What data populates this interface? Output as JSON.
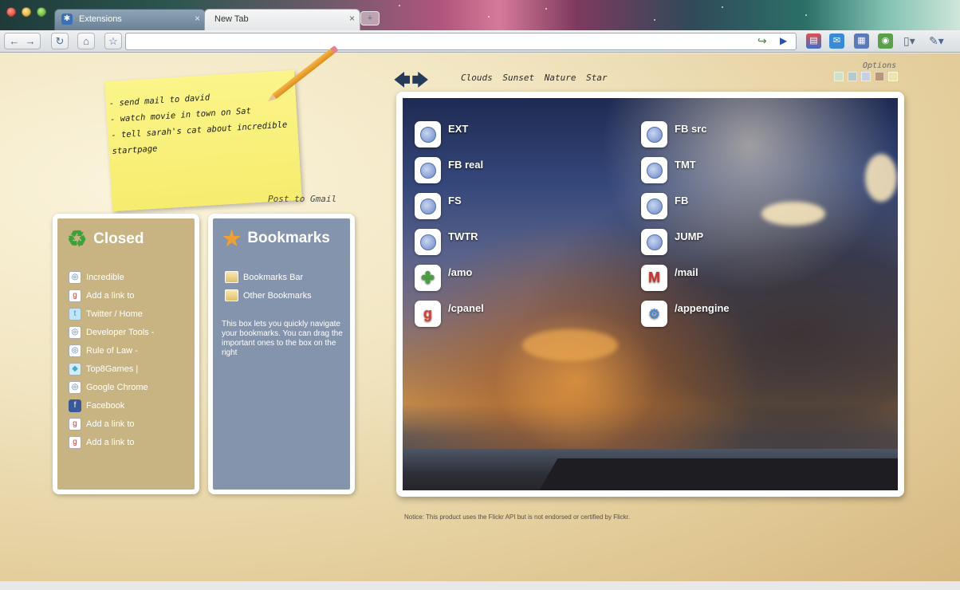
{
  "window": {
    "tabs": [
      {
        "label": "Extensions",
        "active": false
      },
      {
        "label": "New Tab",
        "active": true
      }
    ]
  },
  "toolbar": {
    "url": "",
    "extension_icons": [
      "rss-icon",
      "mail-icon",
      "calendar-icon",
      "reader-icon",
      "page-icon",
      "wrench-icon"
    ]
  },
  "sticky_note": {
    "lines": [
      "- send mail to david",
      "- watch movie in town on Sat",
      "- tell sarah's cat about incredible",
      "startpage"
    ],
    "post_label": "Post to Gmail"
  },
  "themes": {
    "prev_arrow": "🡄",
    "next_arrow": "🡆",
    "links": [
      "Clouds",
      "Sunset",
      "Nature",
      "Star"
    ],
    "options_label": "Options",
    "swatches": [
      "#cfe0c4",
      "#b8c8c8",
      "#c8d0e4",
      "#b89878",
      "#efe4b0"
    ]
  },
  "closed_panel": {
    "title": "Closed",
    "items": [
      {
        "label": "Incredible",
        "icon": "globe-icon"
      },
      {
        "label": "Add a link to",
        "icon": "google-icon"
      },
      {
        "label": "Twitter / Home",
        "icon": "twitter-icon"
      },
      {
        "label": "Developer Tools -",
        "icon": "globe-icon"
      },
      {
        "label": "Rule of Law -",
        "icon": "globe-icon"
      },
      {
        "label": "Top8Games |",
        "icon": "game-icon"
      },
      {
        "label": "Google Chrome",
        "icon": "globe-icon"
      },
      {
        "label": "Facebook",
        "icon": "facebook-icon"
      },
      {
        "label": "Add a link to",
        "icon": "google-icon"
      },
      {
        "label": "Add a link to",
        "icon": "google-icon"
      }
    ]
  },
  "bookmarks_panel": {
    "title": "Bookmarks",
    "items": [
      {
        "label": "Bookmarks Bar"
      },
      {
        "label": "Other Bookmarks"
      }
    ],
    "description": "This box lets you quickly navigate your bookmarks. You can drag the important ones to the box on the right"
  },
  "shortcuts": {
    "left": [
      {
        "label": "EXT",
        "icon": "globe-icon"
      },
      {
        "label": "FB real",
        "icon": "globe-icon"
      },
      {
        "label": "FS",
        "icon": "globe-icon"
      },
      {
        "label": "TWTR",
        "icon": "globe-icon"
      },
      {
        "label": "/amo",
        "icon": "addons-icon"
      },
      {
        "label": "/cpanel",
        "icon": "google-icon"
      }
    ],
    "right": [
      {
        "label": "FB src",
        "icon": "globe-icon"
      },
      {
        "label": "TMT",
        "icon": "globe-icon"
      },
      {
        "label": "FB",
        "icon": "globe-icon"
      },
      {
        "label": "JUMP",
        "icon": "globe-icon"
      },
      {
        "label": "/mail",
        "icon": "gmail-icon"
      },
      {
        "label": "/appengine",
        "icon": "appengine-icon"
      }
    ]
  },
  "notice": "Notice: This product uses the Flickr API but is not endorsed or certified by Flickr."
}
